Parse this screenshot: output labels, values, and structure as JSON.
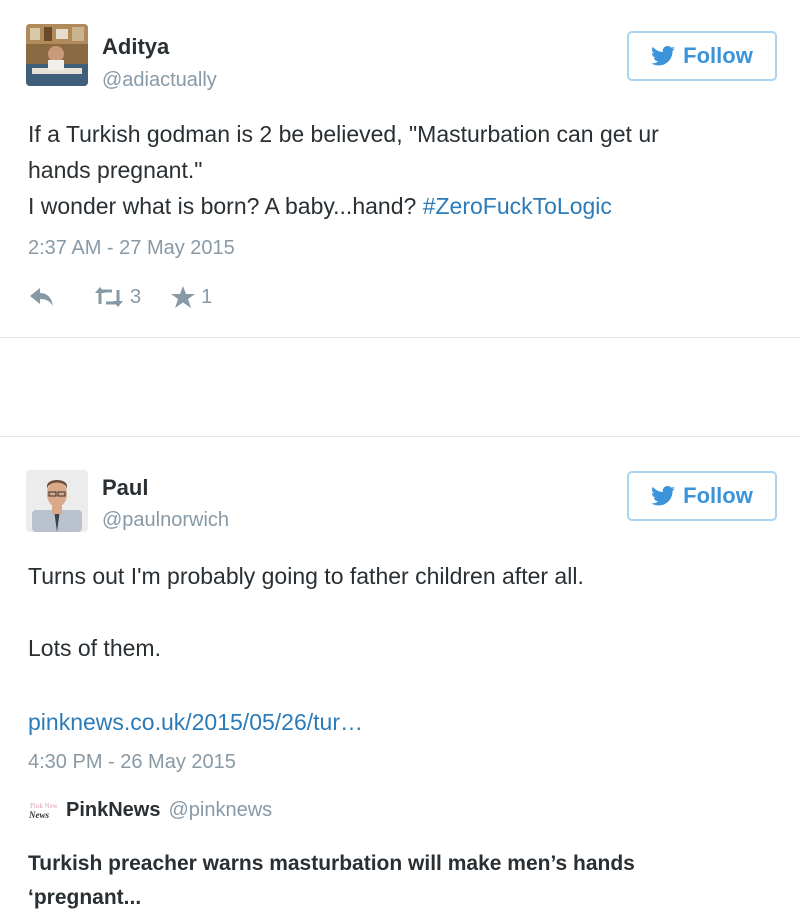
{
  "accent_color": "#2b7bb9",
  "tweets": [
    {
      "author_name": "Aditya",
      "author_handle": "@adiactually",
      "follow_label": "Follow",
      "text_lines": [
        "If a Turkish godman is 2 be believed, \"Masturbation can get ur",
        "hands pregnant.\"",
        "I wonder what is born? A baby...hand? "
      ],
      "hashtag": "#ZeroFuckToLogic",
      "timestamp": "2:37 AM - 27 May 2015",
      "retweet_count": "3",
      "favorite_count": "1"
    },
    {
      "author_name": "Paul",
      "author_handle": "@paulnorwich",
      "follow_label": "Follow",
      "text_line_1": "Turns out I'm probably going to father children after all.",
      "text_line_2": "Lots of them.",
      "link": "pinknews.co.uk/2015/05/26/tur…",
      "timestamp": "4:30 PM - 26 May 2015",
      "quote": {
        "logo_text": "Pink News",
        "name": "PinkNews",
        "handle": "@pinknews",
        "title_lines": [
          "Turkish preacher warns masturbation will make men’s hands",
          "‘pregnant..."
        ]
      }
    }
  ]
}
